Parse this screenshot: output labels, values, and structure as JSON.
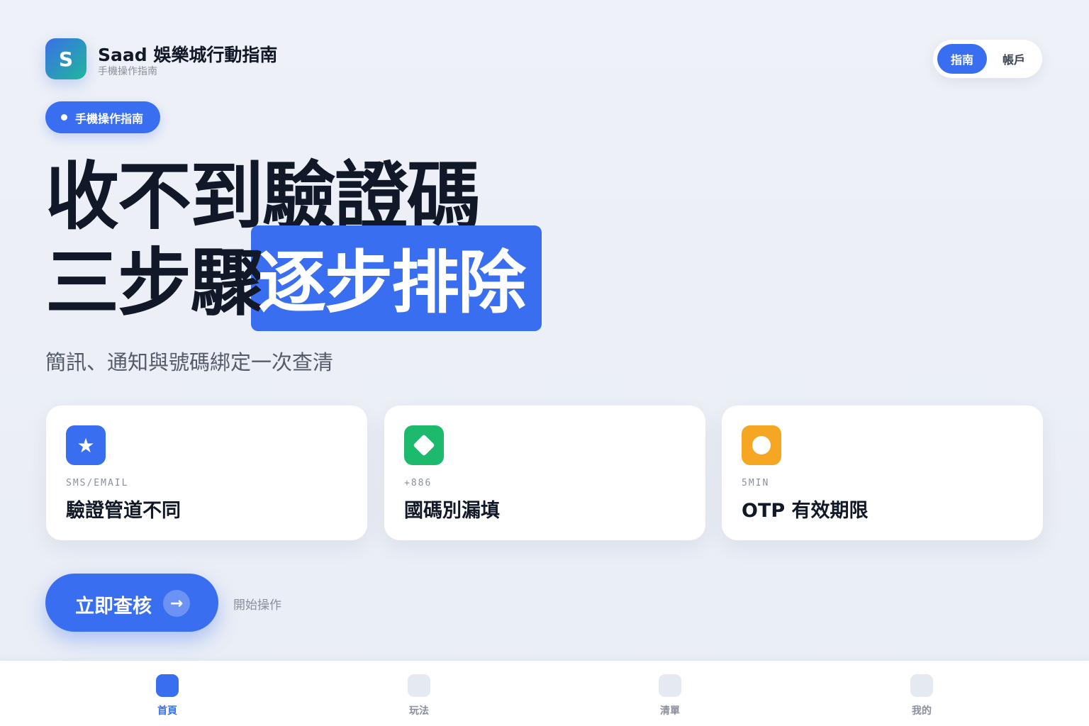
{
  "header": {
    "logo_letter": "S",
    "app_title": "Saad 娛樂城行動指南",
    "app_subtitle": "手機操作指南",
    "segment": {
      "active": "指南",
      "inactive": "帳戶"
    }
  },
  "badge": "手機操作指南",
  "hero": {
    "line1": "收不到驗證碼",
    "line2_plain": "三步驟",
    "line2_highlight": "逐步排除"
  },
  "subtitle": "簡訊、通知與號碼綁定一次查清",
  "cards": [
    {
      "icon": "star-icon",
      "color": "#3a6ef0",
      "tag": "SMS/EMAIL",
      "title": "驗證管道不同"
    },
    {
      "icon": "diamond-icon",
      "color": "#1db96d",
      "tag": "+886",
      "title": "國碼別漏填"
    },
    {
      "icon": "circle-icon",
      "color": "#f5a623",
      "tag": "5MIN",
      "title": "OTP 有效期限"
    }
  ],
  "cta": {
    "label": "立即查核",
    "arrow": "→",
    "hint": "開始操作"
  },
  "tabbar": [
    {
      "label": "首頁",
      "active": true
    },
    {
      "label": "玩法",
      "active": false
    },
    {
      "label": "清單",
      "active": false
    },
    {
      "label": "我的",
      "active": false
    }
  ],
  "colors": {
    "accent": "#3a6ef0",
    "background": "#eef1f7",
    "text": "#111827"
  }
}
